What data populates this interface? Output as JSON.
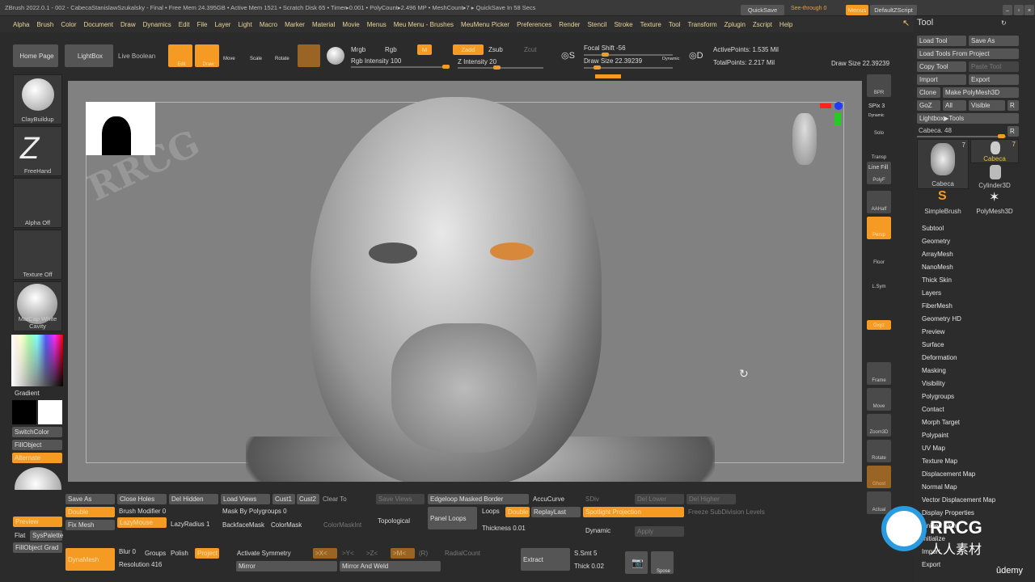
{
  "title_bar": {
    "text": "ZBrush 2022.0.1 - 002 - CabecaStanislawSzukalsky - Final  • Free Mem 24.395GB • Active Mem 1521 • Scratch Disk 65 • Timer▸0.001 • PolyCount▸2.496 MP • MeshCount▸7 ▸ QuickSave In 58 Secs",
    "quicksave": "QuickSave",
    "see_through": "See-through 0",
    "menus": "Menus",
    "default_zscript": "DefaultZScript"
  },
  "menu": [
    "Alpha",
    "Brush",
    "Color",
    "Document",
    "Draw",
    "Dynamics",
    "Edit",
    "File",
    "Layer",
    "Light",
    "Macro",
    "Marker",
    "Material",
    "Movie",
    "Menus",
    "Meu Menu - Brushes",
    "MeuMenu Picker",
    "Preferences",
    "Render",
    "Stencil",
    "Stroke",
    "Texture",
    "Tool",
    "Transform",
    "Zplugin",
    "Zscript",
    "Help"
  ],
  "toolbar": {
    "home": "Home Page",
    "lightbox": "LightBox",
    "live_boolean": "Live Boolean",
    "edit": "Edit",
    "draw": "Draw",
    "move": "Move",
    "scale": "Scale",
    "rotate": "Rotate",
    "mrgb": "Mrgb",
    "rgb": "Rgb",
    "m": "M",
    "rgb_intensity": "Rgb Intensity 100",
    "zadd": "Zadd",
    "zsub": "Zsub",
    "zcut": "Zcut",
    "z_intensity": "Z Intensity 20",
    "focal_shift": "Focal Shift -56",
    "draw_size": "Draw Size 22.39239",
    "dynamic": "Dynamic",
    "active_points": "ActivePoints: 1.535 Mil",
    "total_points": "TotalPoints: 2.217 Mil",
    "draw_size_right": "Draw Size 22.39239",
    "rgb_intensity_value": 100,
    "z_intensity_value": 20
  },
  "left_shelf": {
    "brush": "ClayBuildup",
    "stroke": "FreeHand",
    "alpha": "Alpha Off",
    "texture": "Texture Off",
    "material": "MatCap White Cavity",
    "gradient": "Gradient",
    "switch_color": "SwitchColor",
    "fill_object": "FillObject",
    "alternate": "Alternate"
  },
  "right_shelf": [
    "BPR",
    "SPix 3",
    "Dynamic",
    "Solo",
    "Transp",
    "Line Fill",
    "PolyF",
    "AAHalf",
    "Persp",
    "Floor",
    "L.Sym",
    "Gxyz",
    "Frame",
    "Move",
    "Zoom3D",
    "Rotate",
    "Ghost",
    "Actual"
  ],
  "tool_panel": {
    "header": "Tool",
    "load_tool": "Load Tool",
    "save_as": "Save As",
    "load_from_project": "Load Tools From Project",
    "copy_tool": "Copy Tool",
    "paste_tool": "Paste Tool",
    "import": "Import",
    "export": "Export",
    "clone": "Clone",
    "make_polymesh": "Make PolyMesh3D",
    "goz": "GoZ",
    "all": "All",
    "visible": "Visible",
    "r": "R",
    "lightbox_tools": "Lightbox▶Tools",
    "current_tool": "Cabeca. 48",
    "thumbs": [
      {
        "name": "Cabeca",
        "count": "7"
      },
      {
        "name": "Cabeca",
        "count": "7"
      },
      {
        "name": "Cylinder3D"
      },
      {
        "name": "SimpleBrush"
      },
      {
        "name": "PolyMesh3D"
      }
    ],
    "sections": [
      "Subtool",
      "Geometry",
      "ArrayMesh",
      "NanoMesh",
      "Thick Skin",
      "Layers",
      "FiberMesh",
      "Geometry HD",
      "Preview",
      "Surface",
      "Deformation",
      "Masking",
      "Visibility",
      "Polygroups",
      "Contact",
      "Morph Target",
      "Polypaint",
      "UV Map",
      "Texture Map",
      "Displacement Map",
      "Normal Map",
      "Vector Displacement Map",
      "Display Properties",
      "Unified Skin",
      "Initialize",
      "Import",
      "Export"
    ]
  },
  "bottom": {
    "preview": "Preview",
    "flat": "Flat",
    "syspalette": "SysPalette",
    "fillobject_grad": "FillObject Grad",
    "save_as": "Save As",
    "double": "Double",
    "fix_mesh": "Fix Mesh",
    "close_holes": "Close Holes",
    "brush_modifier": "Brush Modifier 0",
    "lazymouse": "LazyMouse",
    "del_hidden": "Del Hidden",
    "lazyradius": "LazyRadius 1",
    "load_views": "Load Views",
    "cust1": "Cust1",
    "cust2": "Cust2",
    "clear_to": "Clear To",
    "mask_by_polygroups": "Mask By Polygroups 0",
    "backfacemask": "BackfaceMask",
    "colormask": "ColorMask",
    "colormaskint": "ColorMaskInt",
    "save_views": "Save Views",
    "topological": "Topological",
    "edgeloop": "Edgeloop Masked Border",
    "panel_loops": "Panel Loops",
    "loops": "Loops",
    "double2": "Double",
    "thickness": "Thickness 0.01",
    "accucurve": "AccuCurve",
    "replaylast": "ReplayLast",
    "dynamic": "Dynamic",
    "sdiv": "SDiv",
    "spotlight": "Spotlight Projection",
    "apply": "Apply",
    "del_lower": "Del Lower",
    "del_higher": "Del Higher",
    "freeze": "Freeze SubDivision Levels",
    "dynamesh": "DynaMesh",
    "blur": "Blur 0",
    "groups": "Groups",
    "polish": "Polish",
    "project": "Project",
    "resolution": "Resolution 416",
    "activate_symmetry": "Activate Symmetry",
    "x": ">X<",
    "y": ">Y<",
    "z": ">Z<",
    "m": ">M<",
    "r": "(R)",
    "radialcount": "RadialCount",
    "mirror": "Mirror",
    "mirror_weld": "Mirror And Weld",
    "extract": "Extract",
    "smt": "S.Smt 5",
    "thick": "Thick 0.02",
    "spose": "Spose"
  },
  "watermark": {
    "text": "RRCG",
    "sub": "人人素材",
    "udemy": "ûdemy"
  },
  "colors": {
    "accent": "#f59a23",
    "panel": "#2b2b2b",
    "viewport": "#818181"
  }
}
